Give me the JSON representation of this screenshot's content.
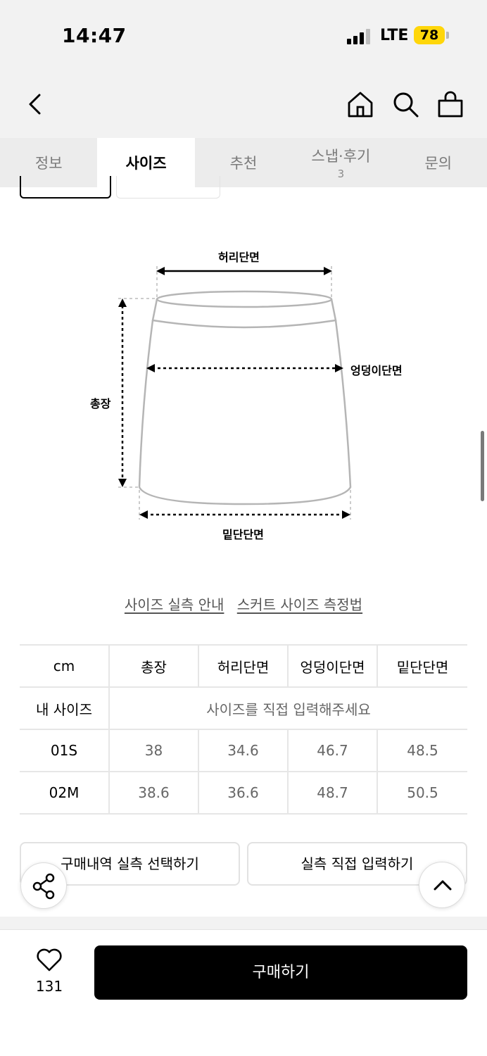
{
  "status_bar": {
    "time": "14:47",
    "network": "LTE",
    "battery": "78",
    "battery_color": "#ffd60a"
  },
  "nav": {
    "back_icon": "chevron-left-icon",
    "home_icon": "home-icon",
    "search_icon": "search-icon",
    "cart_icon": "shopping-bag-icon"
  },
  "tabs": [
    {
      "label": "정보",
      "active": false
    },
    {
      "label": "사이즈",
      "active": true
    },
    {
      "label": "추천",
      "active": false
    },
    {
      "label": "스냅·후기",
      "count": "3",
      "active": false
    },
    {
      "label": "문의",
      "active": false
    }
  ],
  "diagram": {
    "waist": "허리단면",
    "hip": "엉덩이단면",
    "length": "총장",
    "hem": "밑단단면"
  },
  "links": {
    "guide": "사이즈 실측 안내",
    "method": "스커트 사이즈 측정법"
  },
  "size_table": {
    "headers": [
      "cm",
      "총장",
      "허리단면",
      "엉덩이단면",
      "밑단단면"
    ],
    "my_size_label": "내 사이즈",
    "my_size_placeholder": "사이즈를 직접 입력해주세요",
    "rows": [
      {
        "size": "01S",
        "values": [
          "38",
          "34.6",
          "46.7",
          "48.5"
        ]
      },
      {
        "size": "02M",
        "values": [
          "38.6",
          "36.6",
          "48.7",
          "50.5"
        ]
      }
    ]
  },
  "buttons": {
    "select_purchase": "구매내역 실측 선택하기",
    "direct_input": "실측 직접 입력하기",
    "buy": "구매하기"
  },
  "bottom": {
    "like_count": "131",
    "like_icon": "heart-icon",
    "share_icon": "share-icon",
    "top_icon": "chevron-up-icon"
  }
}
